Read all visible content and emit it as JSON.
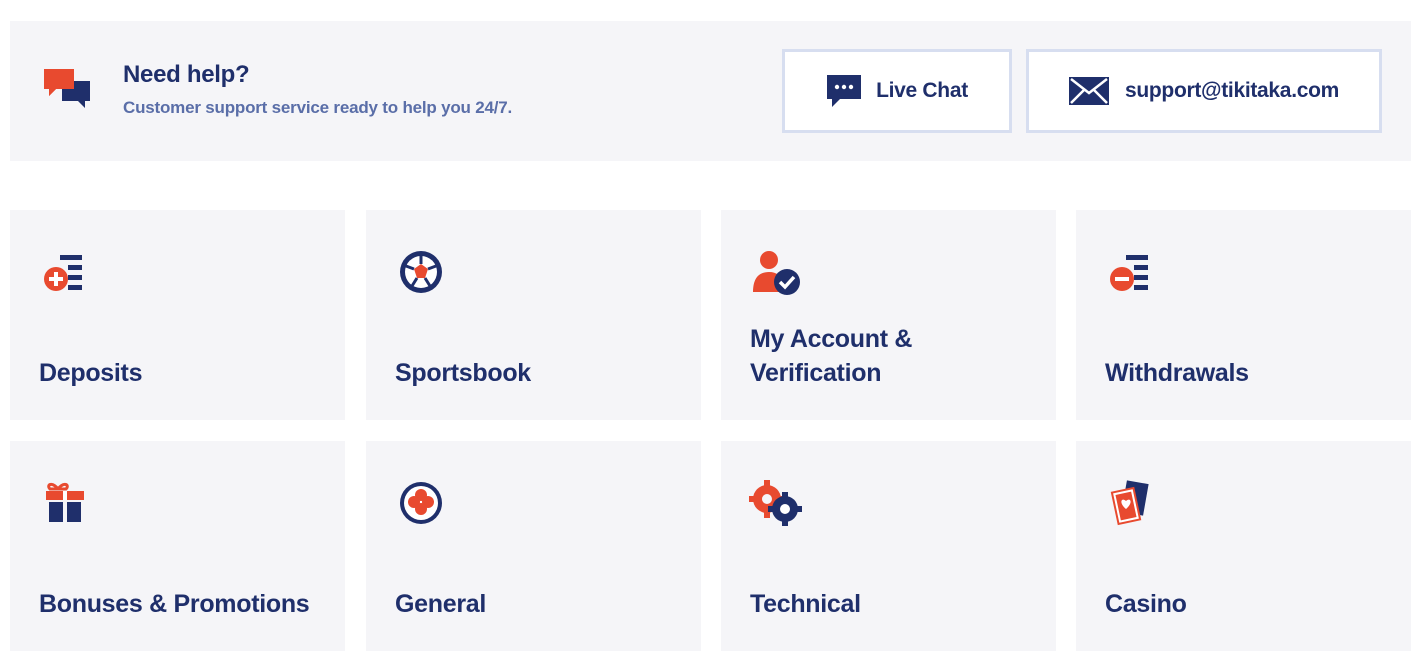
{
  "help": {
    "title": "Need help?",
    "subtitle": "Customer support service ready to help you 24/7."
  },
  "actions": {
    "chat_label": "Live Chat",
    "email_label": "support@tikitaka.com"
  },
  "categories": [
    {
      "label": "Deposits",
      "icon": "deposit-icon"
    },
    {
      "label": "Sportsbook",
      "icon": "soccer-ball-icon"
    },
    {
      "label": "My Account & Verification",
      "icon": "account-verified-icon"
    },
    {
      "label": "Withdrawals",
      "icon": "withdrawal-icon"
    },
    {
      "label": "Bonuses & Promotions",
      "icon": "gift-icon"
    },
    {
      "label": "General",
      "icon": "clover-icon"
    },
    {
      "label": "Technical",
      "icon": "gears-icon"
    },
    {
      "label": "Casino",
      "icon": "playing-cards-icon"
    }
  ],
  "colors": {
    "navy": "#1f2f6b",
    "accent": "#e84a2f",
    "panel": "#f5f5f8",
    "subtitle": "#5a6ea8",
    "button_border": "#d7def0"
  }
}
